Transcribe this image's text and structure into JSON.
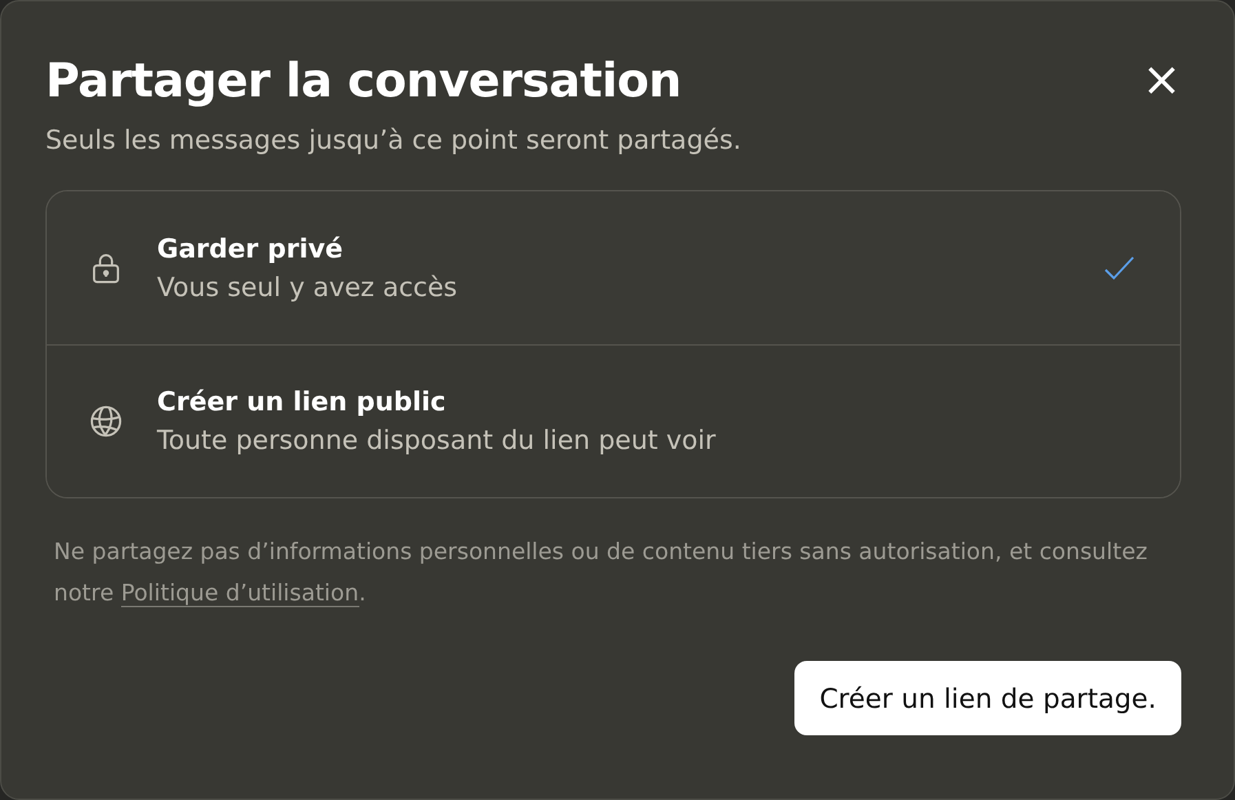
{
  "dialog": {
    "title": "Partager la conversation",
    "subtitle": "Seuls les messages jusqu’à ce point seront partagés.",
    "close_symbol": "×"
  },
  "options": [
    {
      "kind": "lock",
      "label": "Garder privé",
      "description": "Vous seul y avez accès",
      "selected": true
    },
    {
      "kind": "globe",
      "label": "Créer un lien public",
      "description": "Toute personne disposant du lien peut voir",
      "selected": false
    }
  ],
  "notice": {
    "text": "Ne partagez pas d’informations personnelles ou de contenu tiers sans autorisation, et consultez notre ",
    "link": "Politique d’utilisation",
    "end": "."
  },
  "button": "Créer un lien de partage."
}
